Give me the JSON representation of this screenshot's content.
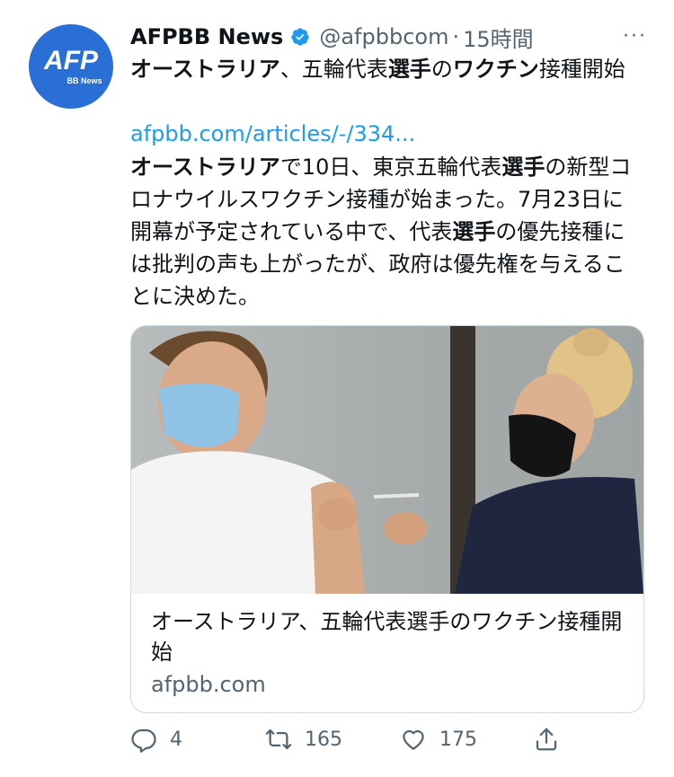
{
  "tweet": {
    "avatar": {
      "logo": "AFP",
      "sub": "BB News"
    },
    "display_name": "AFPBB News",
    "handle": "@afpbbcom",
    "separator": "·",
    "time": "15時間",
    "more": "···",
    "title": {
      "p1": "オーストラリア",
      "p2": "、五輪代表",
      "p3": "選手",
      "p4": "の",
      "p5": "ワクチン",
      "p6": "接種開始"
    },
    "link": "afpbb.com/articles/-/334...",
    "body": {
      "p1": "オーストラリア",
      "p2": "で10日、東京五輪代表",
      "p3": "選手",
      "p4": "の新型コロナウイルスワクチン接種が始まった。7月23日に開幕が予定されている中で、代表",
      "p5": "選手",
      "p6": "の優先接種には批判の声も上がったが、政府は優先権を与えることに決めた。"
    },
    "card": {
      "title": "オーストラリア、五輪代表選手のワクチン接種開始",
      "domain": "afpbb.com"
    },
    "actions": {
      "reply_count": "4",
      "retweet_count": "165",
      "like_count": "175"
    }
  },
  "colors": {
    "accent": "#1d9bf0",
    "avatar_bg": "#2a6fd6",
    "muted": "#536471"
  }
}
